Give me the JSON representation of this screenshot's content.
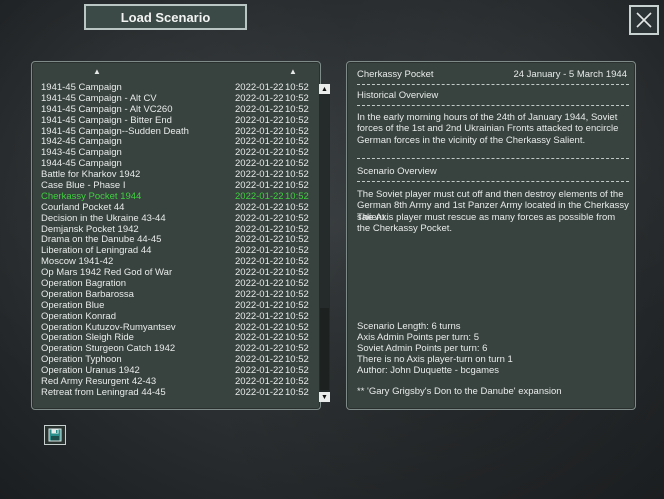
{
  "window": {
    "title": "Load Scenario"
  },
  "list": {
    "scenarios": [
      {
        "name": "1941-45 Campaign",
        "date": "2022-01-22",
        "time": "10:52"
      },
      {
        "name": "1941-45 Campaign - Alt CV",
        "date": "2022-01-22",
        "time": "10:52"
      },
      {
        "name": "1941-45 Campaign - Alt VC260",
        "date": "2022-01-22",
        "time": "10:52"
      },
      {
        "name": "1941-45 Campaign - Bitter End",
        "date": "2022-01-22",
        "time": "10:52"
      },
      {
        "name": "1941-45 Campaign--Sudden Death",
        "date": "2022-01-22",
        "time": "10:52"
      },
      {
        "name": "1942-45 Campaign",
        "date": "2022-01-22",
        "time": "10:52"
      },
      {
        "name": "1943-45 Campaign",
        "date": "2022-01-22",
        "time": "10:52"
      },
      {
        "name": "1944-45 Campaign",
        "date": "2022-01-22",
        "time": "10:52"
      },
      {
        "name": "Battle for Kharkov 1942",
        "date": "2022-01-22",
        "time": "10:52"
      },
      {
        "name": "Case Blue - Phase I",
        "date": "2022-01-22",
        "time": "10:52"
      },
      {
        "name": "Cherkassy Pocket 1944",
        "date": "2022-01-22",
        "time": "10:52",
        "selected": true
      },
      {
        "name": "Courland Pocket 44",
        "date": "2022-01-22",
        "time": "10:52"
      },
      {
        "name": "Decision in the Ukraine 43-44",
        "date": "2022-01-22",
        "time": "10:52"
      },
      {
        "name": "Demjansk Pocket 1942",
        "date": "2022-01-22",
        "time": "10:52"
      },
      {
        "name": "Drama on the Danube 44-45",
        "date": "2022-01-22",
        "time": "10:52"
      },
      {
        "name": "Liberation of Leningrad 44",
        "date": "2022-01-22",
        "time": "10:52"
      },
      {
        "name": "Moscow 1941-42",
        "date": "2022-01-22",
        "time": "10:52"
      },
      {
        "name": "Op Mars 1942 Red God of War",
        "date": "2022-01-22",
        "time": "10:52"
      },
      {
        "name": "Operation Bagration",
        "date": "2022-01-22",
        "time": "10:52"
      },
      {
        "name": "Operation Barbarossa",
        "date": "2022-01-22",
        "time": "10:52"
      },
      {
        "name": "Operation Blue",
        "date": "2022-01-22",
        "time": "10:52"
      },
      {
        "name": "Operation Konrad",
        "date": "2022-01-22",
        "time": "10:52"
      },
      {
        "name": "Operation Kutuzov-Rumyantsev",
        "date": "2022-01-22",
        "time": "10:52"
      },
      {
        "name": "Operation Sleigh Ride",
        "date": "2022-01-22",
        "time": "10:52"
      },
      {
        "name": "Operation Sturgeon Catch 1942",
        "date": "2022-01-22",
        "time": "10:52"
      },
      {
        "name": "Operation Typhoon",
        "date": "2022-01-22",
        "time": "10:52"
      },
      {
        "name": "Operation Uranus 1942",
        "date": "2022-01-22",
        "time": "10:52"
      },
      {
        "name": "Red Army Resurgent 42-43",
        "date": "2022-01-22",
        "time": "10:52"
      },
      {
        "name": "Retreat from Leningrad 44-45",
        "date": "2022-01-22",
        "time": "10:52"
      }
    ]
  },
  "detail": {
    "title": "Cherkassy Pocket",
    "dates": "24 January - 5 March 1944",
    "historical_heading": "Historical Overview",
    "historical_text": "In the early morning hours of the 24th of January 1944, Soviet forces of the 1st and 2nd Ukrainian Fronts attacked to encircle German forces in the vicinity of the Cherkassy Salient.",
    "scenario_heading": "Scenario Overview",
    "scenario_text_1": "The Soviet player must cut off and then destroy elements of the German 8th Army and 1st Panzer Army located in the Cherkassy salient.",
    "scenario_text_2": "The Axis player must rescue as many forces as possible from the Cherkassy Pocket.",
    "length": "Scenario Length: 6 turns",
    "axis_admin": "Axis Admin Points per turn: 5",
    "soviet_admin": "Soviet Admin Points per turn: 6",
    "axis_turn": "There is no Axis player-turn on turn 1",
    "author": "Author: John Duquette - bcgames",
    "expansion": "** 'Gary Grigsby's Don to the Danube' expansion"
  },
  "icons": {
    "sort_up": "▲",
    "scroll_up": "▲",
    "scroll_down": "▼"
  },
  "colors": {
    "selected": "#3fd13f",
    "panel": "#38423f"
  }
}
